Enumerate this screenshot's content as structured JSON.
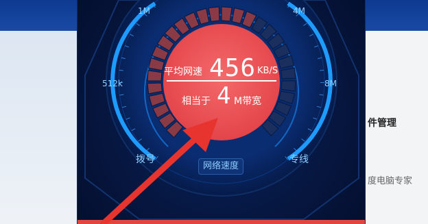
{
  "background": {
    "right_label_1": "件管理",
    "right_label_2": "度电脑专家"
  },
  "gauge": {
    "scale_labels": {
      "l1m": "1M",
      "l4m": "4M",
      "l512k": "512k",
      "l8m": "8M",
      "dialup": "拨号",
      "dedicated": "专线"
    },
    "avg_speed_label": "平均网速",
    "avg_speed_value": "456",
    "avg_speed_unit": "KB/S",
    "equiv_label": "相当于",
    "equiv_value": "4",
    "equiv_unit": "M带宽",
    "speed_button": "网络速度"
  },
  "colors": {
    "accent_red": "#e84a4a",
    "gauge_blue": "#1e9bff",
    "panel_dark": "#061a45",
    "arrow_red": "#e8342f"
  },
  "icons": {
    "pointer": "red-arrow-icon"
  }
}
